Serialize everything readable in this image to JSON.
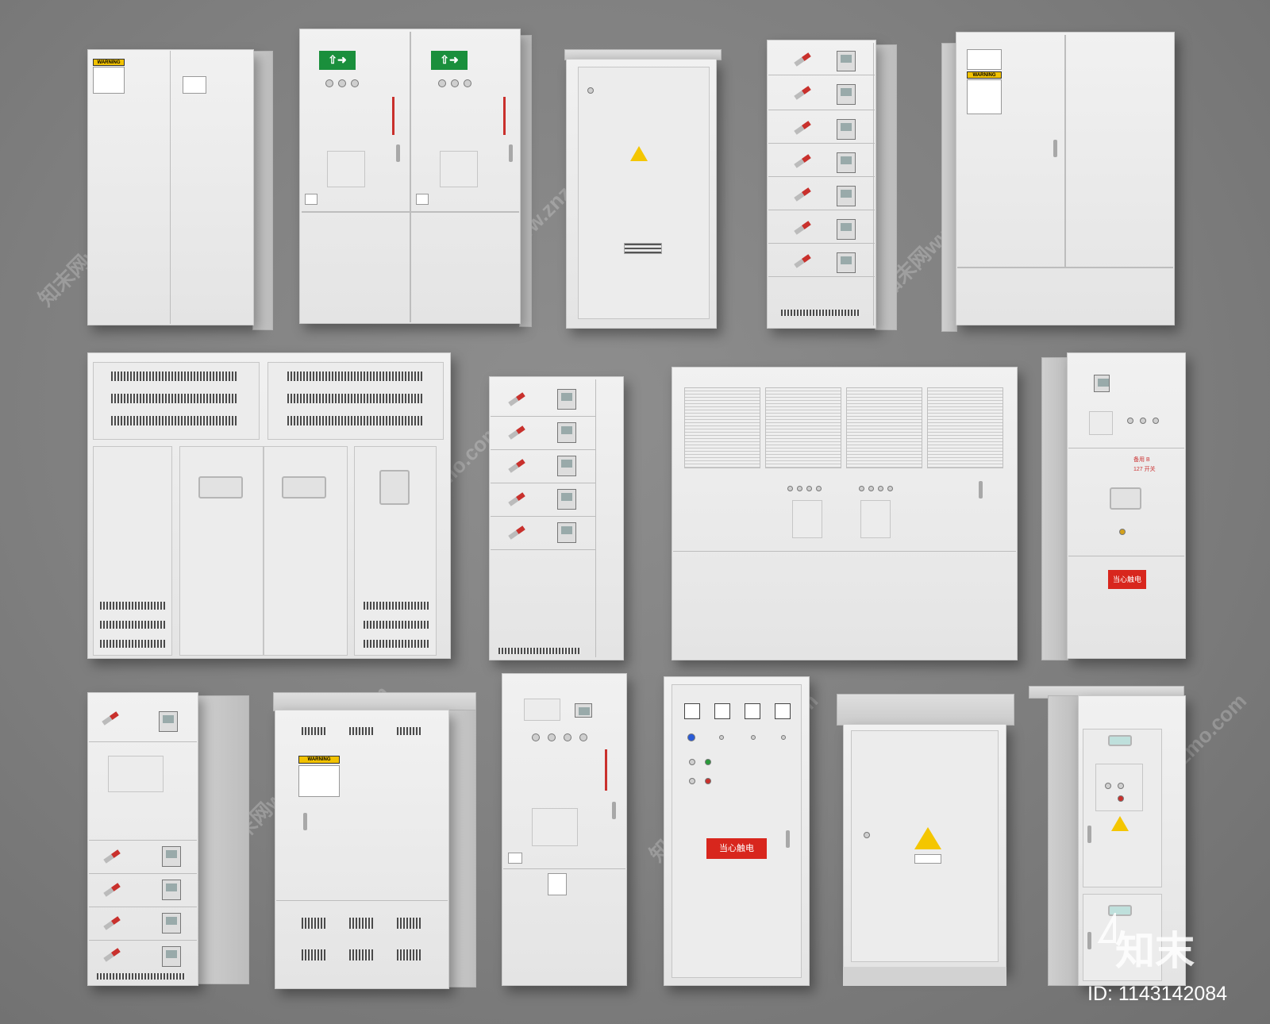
{
  "watermark": {
    "text": "知末网www.znzmo.com"
  },
  "logo": {
    "text": "知末"
  },
  "image_id": {
    "text": "ID: 1143142084"
  },
  "cabinet_text": {
    "warning": "WARNING",
    "danger_zh": "当心触电",
    "spare_line1": "备用 B",
    "spare_line2": "127 开关"
  },
  "colors": {
    "background": "#7f7f7f",
    "cabinet_body": "#e8e8e8",
    "warning_yellow": "#f4c600",
    "danger_red": "#d8261d",
    "exit_green": "#1a8f3c"
  }
}
